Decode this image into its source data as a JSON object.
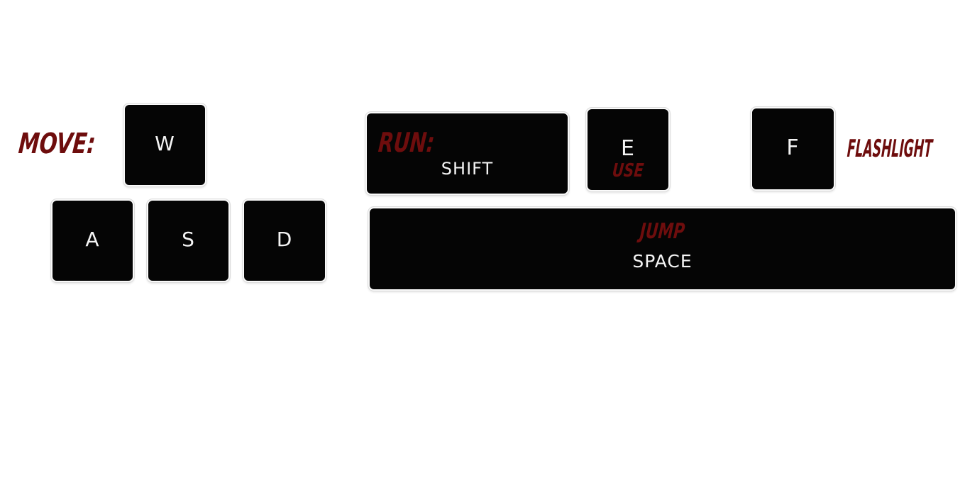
{
  "labels": {
    "move": "MOVE:",
    "run": "RUN:",
    "use": "USE",
    "flashlight": "FLASHLIGHT",
    "jump": "JUMP"
  },
  "keys": {
    "w": "W",
    "a": "A",
    "s": "S",
    "d": "D",
    "shift": "SHIFT",
    "e": "E",
    "f": "F",
    "space": "SPACE"
  },
  "colors": {
    "key_fill": "#050505",
    "key_text": "#f4f4f4",
    "action_label": "#6e0d0d",
    "background": "#ffffff"
  }
}
